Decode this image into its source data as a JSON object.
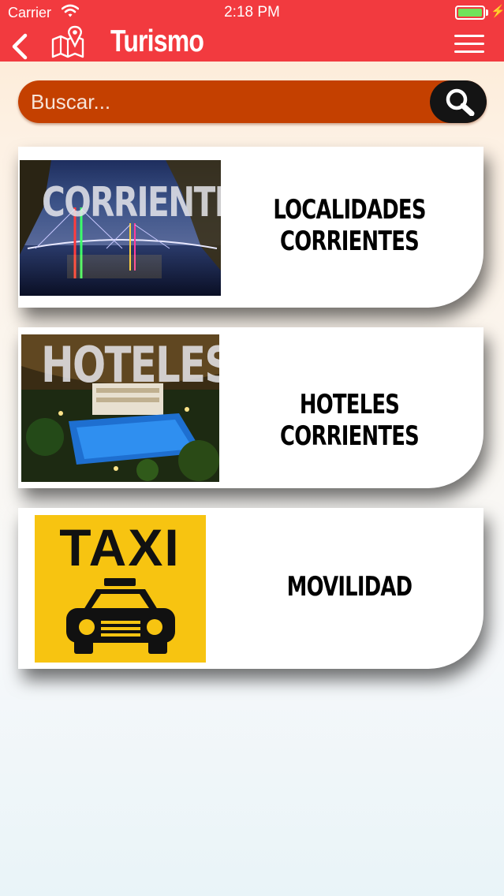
{
  "status_bar": {
    "carrier": "Carrier",
    "time": "2:18 PM",
    "icons": [
      "wifi-icon",
      "battery-icon",
      "charging-bolt-icon"
    ]
  },
  "nav": {
    "title": "Turismo",
    "icons": [
      "back-chevron-icon",
      "map-pin-icon",
      "hamburger-menu-icon"
    ]
  },
  "search": {
    "placeholder": "Buscar...",
    "value": "",
    "icon": "magnifier-icon"
  },
  "cards": [
    {
      "label": "LOCALIDADES CORRIENTES",
      "image_text": "CORRIENTES",
      "image_alt": "night bridge over river"
    },
    {
      "label": "HOTELES CORRIENTES",
      "image_text": "HOTELES",
      "image_alt": "hotel pool at night"
    },
    {
      "label": "MOVILIDAD",
      "image_text": "TAXI",
      "image_alt": "taxi sign"
    }
  ],
  "colors": {
    "nav_bar": "#f23a3f",
    "search_bar": "#c44000",
    "search_button": "#141414",
    "taxi_yellow": "#f7c411"
  }
}
